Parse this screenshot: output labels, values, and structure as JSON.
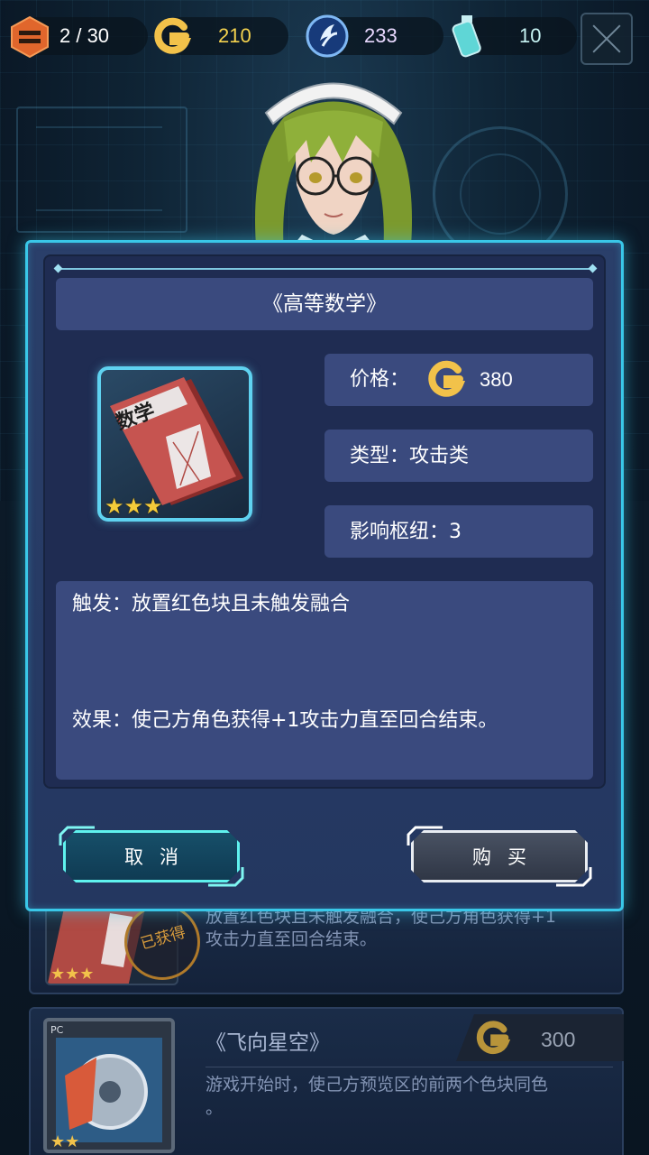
{
  "hud": {
    "progress": "2 / 30",
    "gold": "210",
    "gem": "233",
    "potion": "10"
  },
  "dialog": {
    "title": "《高等数学》",
    "price_label": "价格：",
    "price_value": "380",
    "type_label": "类型：攻击类",
    "hub_label": "影响枢纽：3",
    "trigger": "触发：放置红色块且未触发融合",
    "effect": "效果：使己方角色获得+1攻击力直至回合结束。",
    "card_title": "数学",
    "card_stars": 3,
    "cancel_label": "取消",
    "buy_label": "购买"
  },
  "list": {
    "item1_desc_line1": "放置红色块且未触发融合，使己方角色获得+1",
    "item1_desc_line2": "攻击力直至回合结束。",
    "item1_badge": "已获得",
    "item1_stars": 3,
    "item2_title": "《飞向星空》",
    "item2_price": "300",
    "item2_desc_line1": "游戏开始时，使己方预览区的前两个色块同色",
    "item2_desc_line2": "。",
    "item2_card_label": "PC",
    "item2_stars": 2
  },
  "colors": {
    "accent_cyan": "#39c7e8",
    "panel_blue": "#3a4a7e",
    "gold": "#e8b83a"
  },
  "icons": [
    "level-icon",
    "gold-coin-icon",
    "gem-icon",
    "potion-icon",
    "close-icon",
    "star-icon"
  ]
}
